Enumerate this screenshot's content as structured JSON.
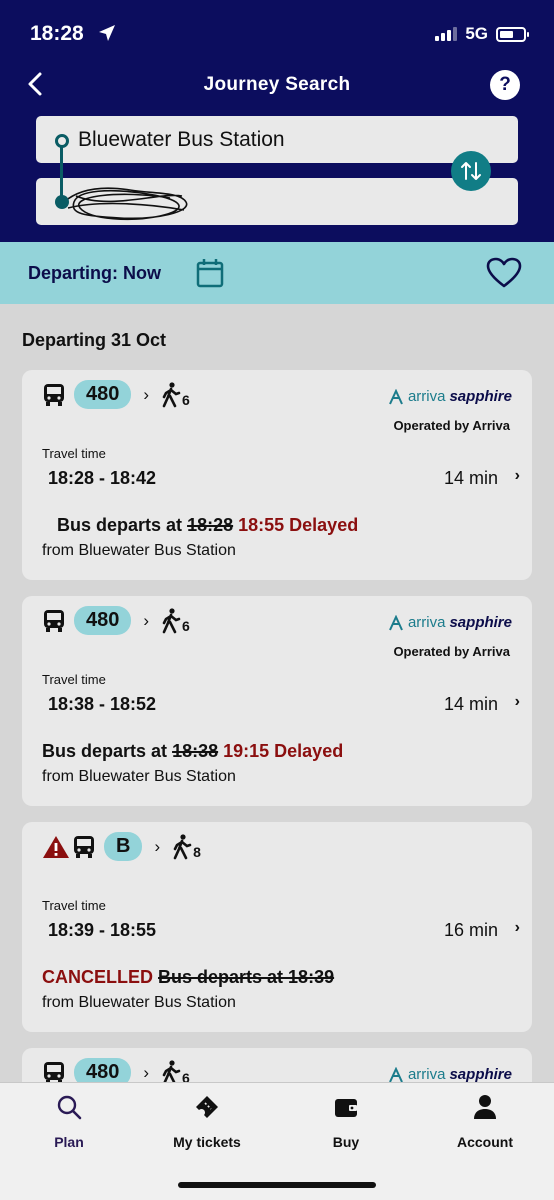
{
  "status": {
    "time": "18:28",
    "network": "5G"
  },
  "nav": {
    "title": "Journey Search",
    "help": "?"
  },
  "search": {
    "from": "Bluewater Bus Station",
    "to": ""
  },
  "depart": {
    "label": "Departing: Now"
  },
  "list": {
    "date_header": "Departing 31 Oct",
    "cards": [
      {
        "route": "480",
        "walk": "6",
        "operator_a": "arriva",
        "operator_b": "sapphire",
        "operated_by": "Operated by Arriva",
        "tt_label": "Travel time",
        "time": "18:28 - 18:42",
        "duration": "14 min",
        "dep_prefix": "Bus departs at",
        "dep_old": "18:28",
        "dep_new": "18:55 Delayed",
        "from": "from Bluewater Bus Station"
      },
      {
        "route": "480",
        "walk": "6",
        "operator_a": "arriva",
        "operator_b": "sapphire",
        "operated_by": "Operated by Arriva",
        "tt_label": "Travel time",
        "time": "18:38 - 18:52",
        "duration": "14 min",
        "dep_prefix": "Bus departs at",
        "dep_old": "18:38",
        "dep_new": "19:15 Delayed",
        "from": "from Bluewater Bus Station"
      },
      {
        "route": "B",
        "walk": "8",
        "tt_label": "Travel time",
        "time": "18:39 - 18:55",
        "duration": "16 min",
        "cancel": "CANCELLED",
        "dep_struck": "Bus departs at 18:39",
        "from": "from Bluewater Bus Station"
      },
      {
        "route": "480",
        "walk": "6",
        "operator_a": "arriva",
        "operator_b": "sapphire"
      }
    ]
  },
  "bottom_nav": [
    {
      "label": "Plan",
      "icon": "search-icon"
    },
    {
      "label": "My tickets",
      "icon": "ticket-icon"
    },
    {
      "label": "Buy",
      "icon": "wallet-icon"
    },
    {
      "label": "Account",
      "icon": "person-icon"
    }
  ],
  "colors": {
    "header": "#0c0d5e",
    "accent": "#93d3d9",
    "teal": "#117d86",
    "delay": "#8b0f0f",
    "plan_active": "#2a1a55"
  }
}
